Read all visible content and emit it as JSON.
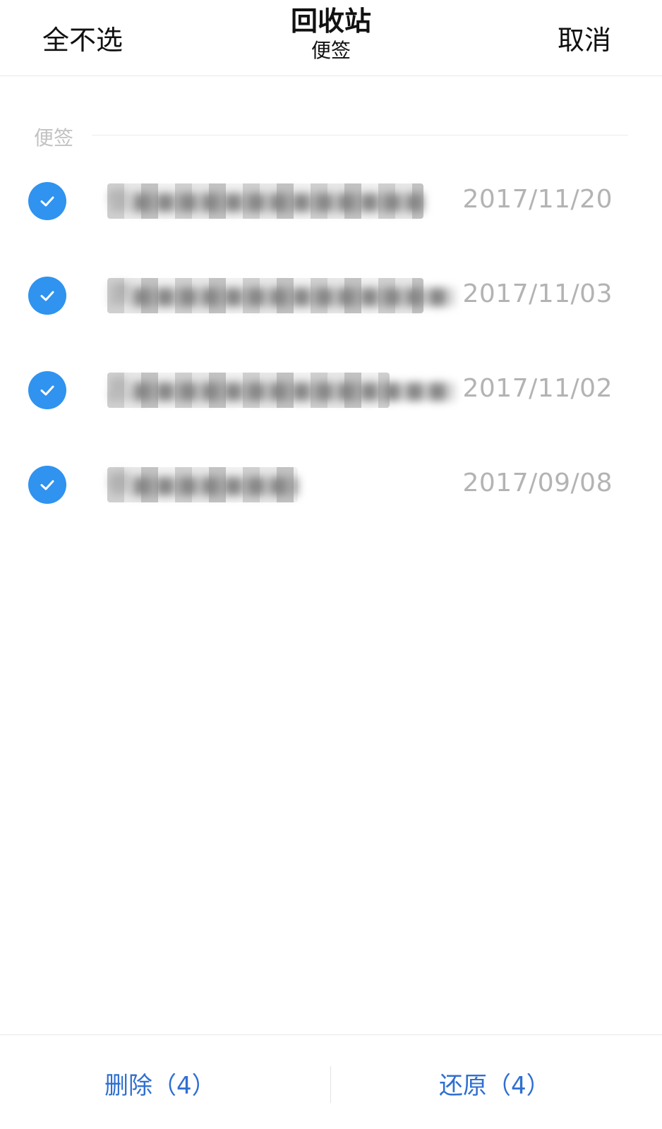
{
  "header": {
    "left_action": "全不选",
    "title": "回收站",
    "subtitle": "便签",
    "right_action": "取消"
  },
  "section": {
    "label": "便签"
  },
  "items": [
    {
      "preview": "信■■■■■■■■■■■■■■■■■",
      "date": "2017/11/20",
      "checked": true
    },
    {
      "preview": "须■■■■■■■■■■■■■■■■■■■■■■■■■■■■■■■■■毛…",
      "date": "2017/11/03",
      "checked": true
    },
    {
      "preview": "吕■■■■■■■■■■■■■■■■■■■■■■■■■■■■■■■■■■■■■■■■■■■■■■■群，…",
      "date": "2017/11/02",
      "checked": true
    },
    {
      "preview": "很■■■■■■■■■",
      "date": "2017/09/08",
      "checked": true
    }
  ],
  "footer": {
    "delete_label": "删除（4）",
    "restore_label": "还原（4）"
  },
  "colors": {
    "accent": "#2f93ef",
    "button_text": "#2f6fd1",
    "date_text": "#b3b3b3"
  }
}
